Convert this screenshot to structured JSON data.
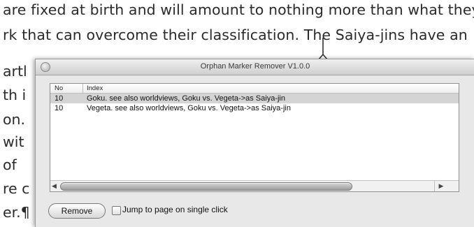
{
  "document": {
    "line1": "are fixed at birth and will amount to nothing more than what they",
    "line2": "rk that can overcome their classification. The Saiya-jins have an",
    "fragments": [
      "artl",
      "th i",
      "on.",
      "wit",
      "of",
      "re c",
      "er.¶"
    ]
  },
  "window": {
    "title": "Orphan Marker Remover V1.0.0"
  },
  "list": {
    "columns": [
      "No",
      "Index"
    ],
    "rows": [
      {
        "no": "10",
        "index": "Goku. see also worldviews, Goku vs. Vegeta->as Saiya-jin",
        "selected": true
      },
      {
        "no": "10",
        "index": "Vegeta. see also worldviews, Goku vs. Vegeta->as Saiya-jin",
        "selected": false
      }
    ]
  },
  "controls": {
    "remove_label": "Remove",
    "jump_label": "Jump to page on single click",
    "jump_checked": false
  },
  "icons": {
    "close": "close-icon",
    "scroll_left": "arrow-left-icon",
    "scroll_right": "arrow-right-icon",
    "text_cursor": "text-cursor-icon"
  }
}
